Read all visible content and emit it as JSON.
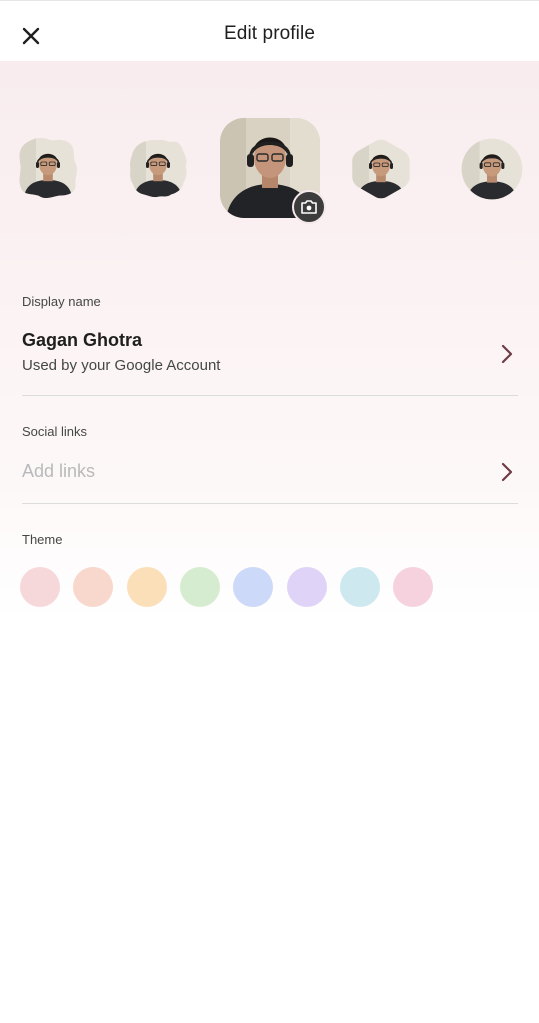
{
  "header": {
    "title": "Edit profile",
    "close_icon": "close-icon"
  },
  "avatar": {
    "options": [
      {
        "shape": "wavy-blob"
      },
      {
        "shape": "scalloped"
      },
      {
        "shape": "rounded-square",
        "selected": true
      },
      {
        "shape": "hexagon-rounded"
      },
      {
        "shape": "circle"
      }
    ],
    "camera_icon": "camera-icon"
  },
  "display_name": {
    "label": "Display name",
    "name": "Gagan Ghotra",
    "sub": "Used by your Google Account"
  },
  "social_links": {
    "label": "Social links",
    "placeholder": "Add links"
  },
  "theme": {
    "label": "Theme",
    "colors": [
      "#f6d8db",
      "#f8d7cc",
      "#fbdfb9",
      "#d6ecd0",
      "#ccd9f8",
      "#e0d3f8",
      "#cde8ee",
      "#f6d2de"
    ]
  },
  "colors": {
    "chevron": "#6d3c45",
    "camera_bg": "#3c3c3c"
  }
}
